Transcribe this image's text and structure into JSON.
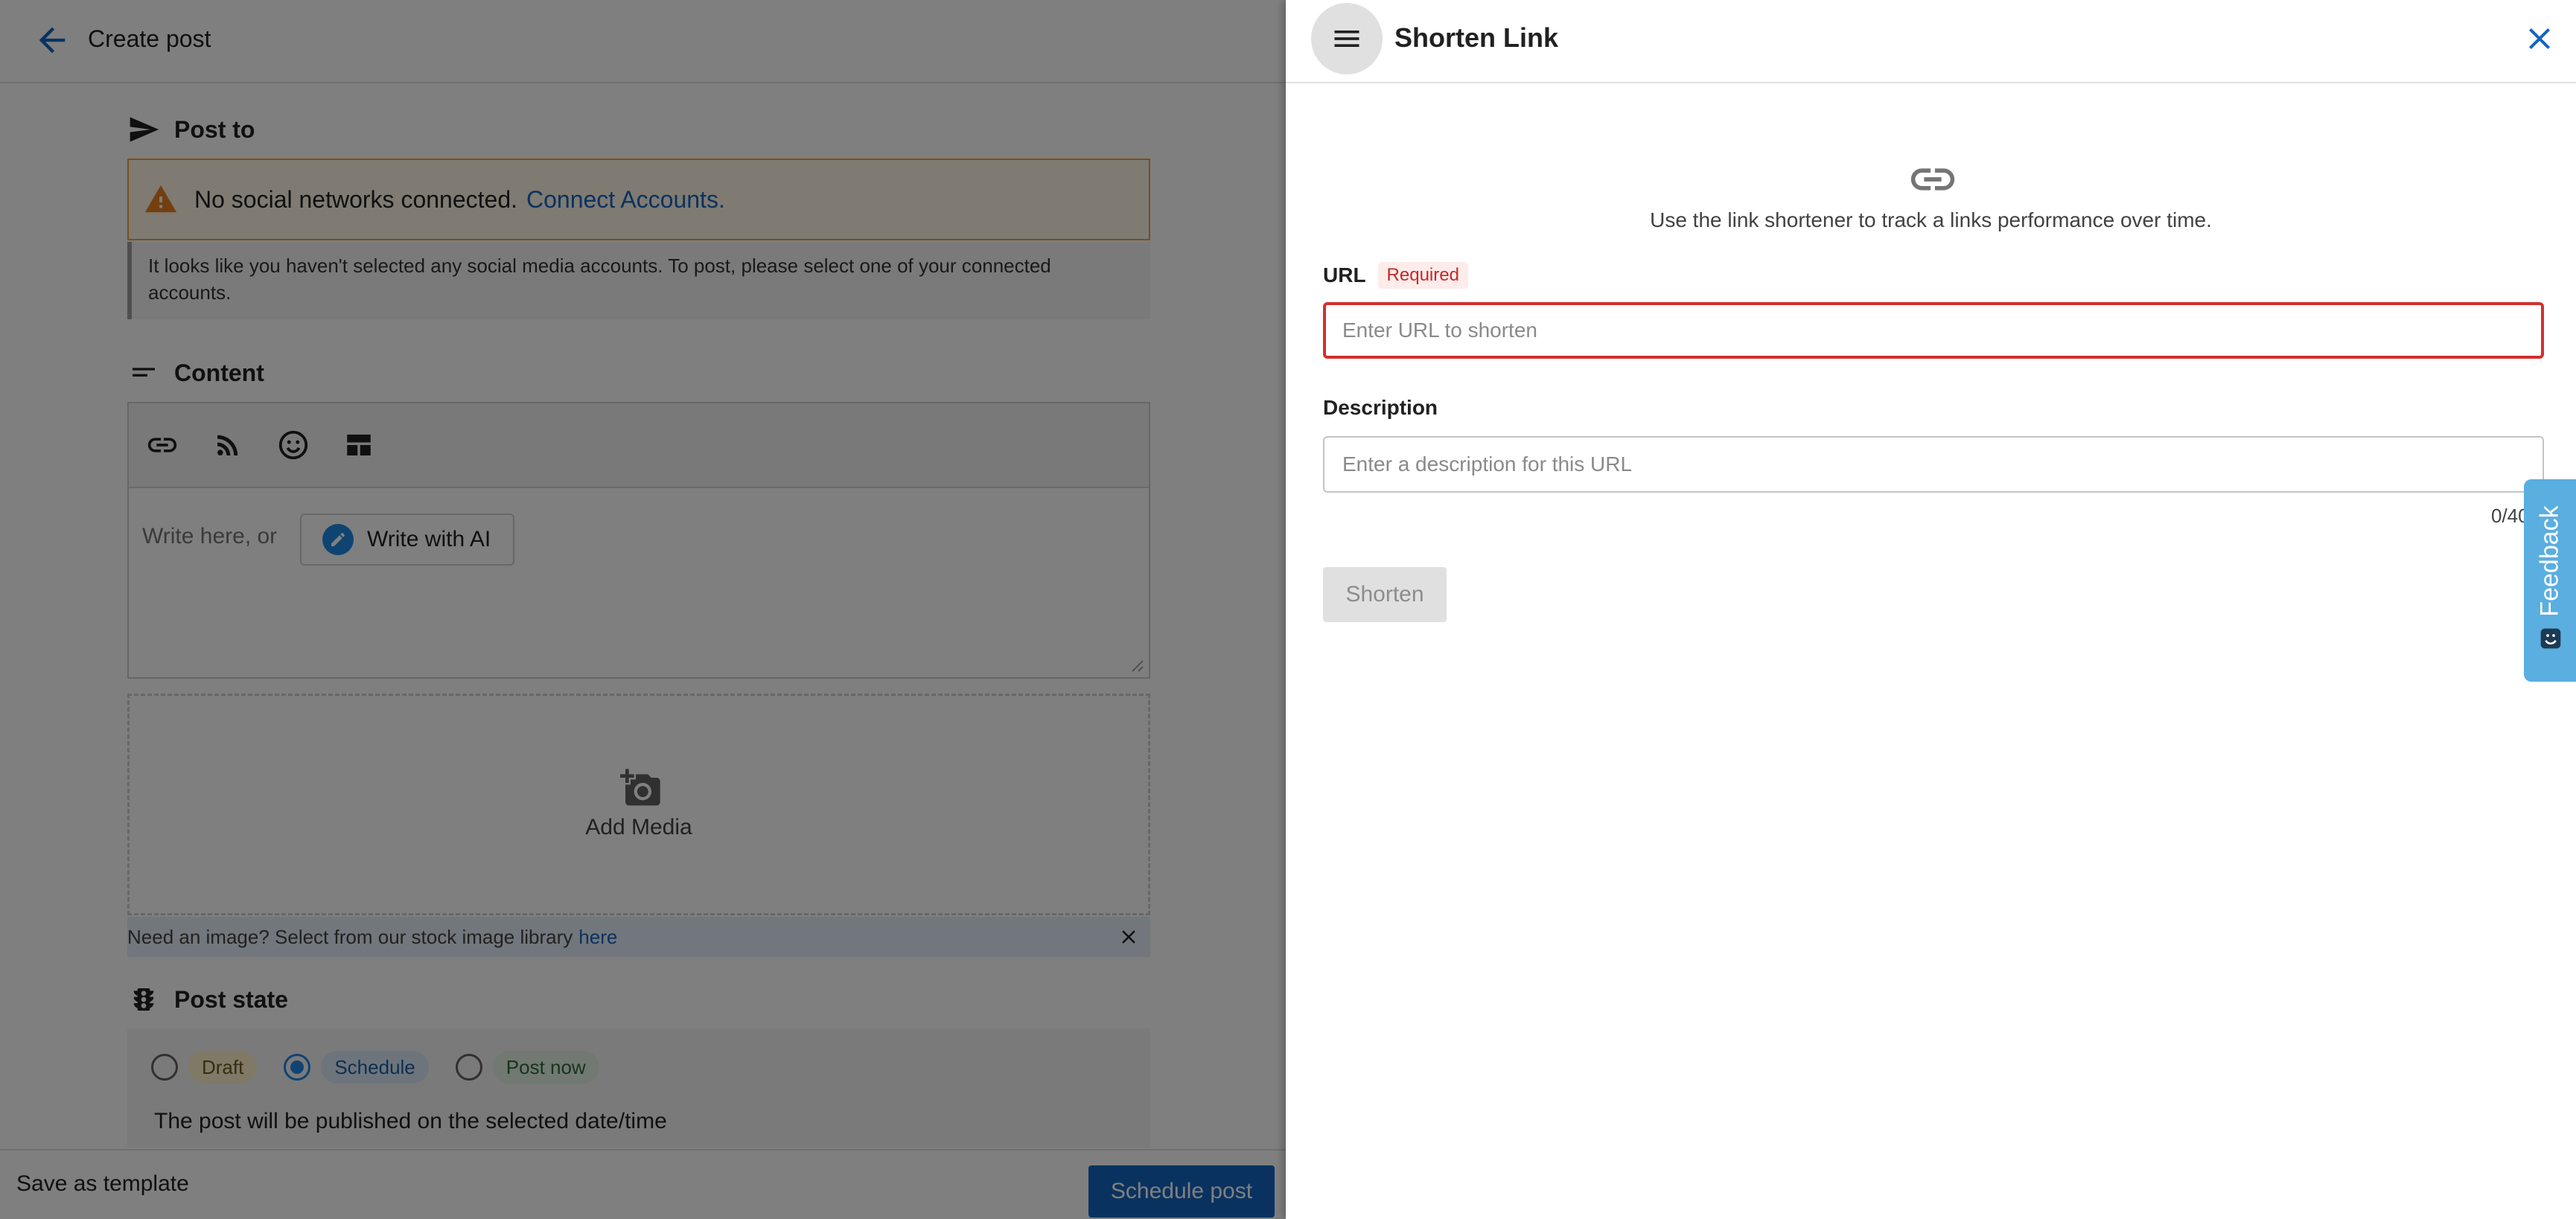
{
  "editor": {
    "back_icon": "arrow-back-icon",
    "title": "Create post",
    "post_to": {
      "heading": "Post to",
      "warning_text": "No social networks connected.",
      "warning_link": "Connect Accounts.",
      "info_text": "It looks like you haven't selected any social media accounts. To post, please select one of your connected accounts."
    },
    "content": {
      "heading": "Content",
      "toolbar_icons": [
        "link-icon",
        "rss-icon",
        "emoji-icon",
        "template-icon"
      ],
      "placeholder": "Write here, or",
      "ai_button": "Write with AI"
    },
    "media": {
      "add_label": "Add Media",
      "stock_text": "Need an image? Select from our stock image library",
      "stock_link": "here"
    },
    "post_state": {
      "heading": "Post state",
      "options": [
        {
          "label": "Draft",
          "selected": false
        },
        {
          "label": "Schedule",
          "selected": true
        },
        {
          "label": "Post now",
          "selected": false
        }
      ],
      "description": "The post will be published on the selected date/time"
    },
    "footer": {
      "save_template": "Save as template",
      "schedule_button": "Schedule post"
    }
  },
  "panel": {
    "title": "Shorten Link",
    "intro": "Use the link shortener to track a links performance over time.",
    "url": {
      "label": "URL",
      "required_badge": "Required",
      "placeholder": "Enter URL to shorten",
      "value": ""
    },
    "description": {
      "label": "Description",
      "placeholder": "Enter a description for this URL",
      "value": "",
      "counter": "0/40"
    },
    "shorten_button": "Shorten",
    "feedback_tab": "Feedback"
  },
  "colors": {
    "accent": "#1565c0",
    "error": "#d32f2f",
    "warning": "#e8a33c",
    "feedback": "#5aaee0"
  }
}
